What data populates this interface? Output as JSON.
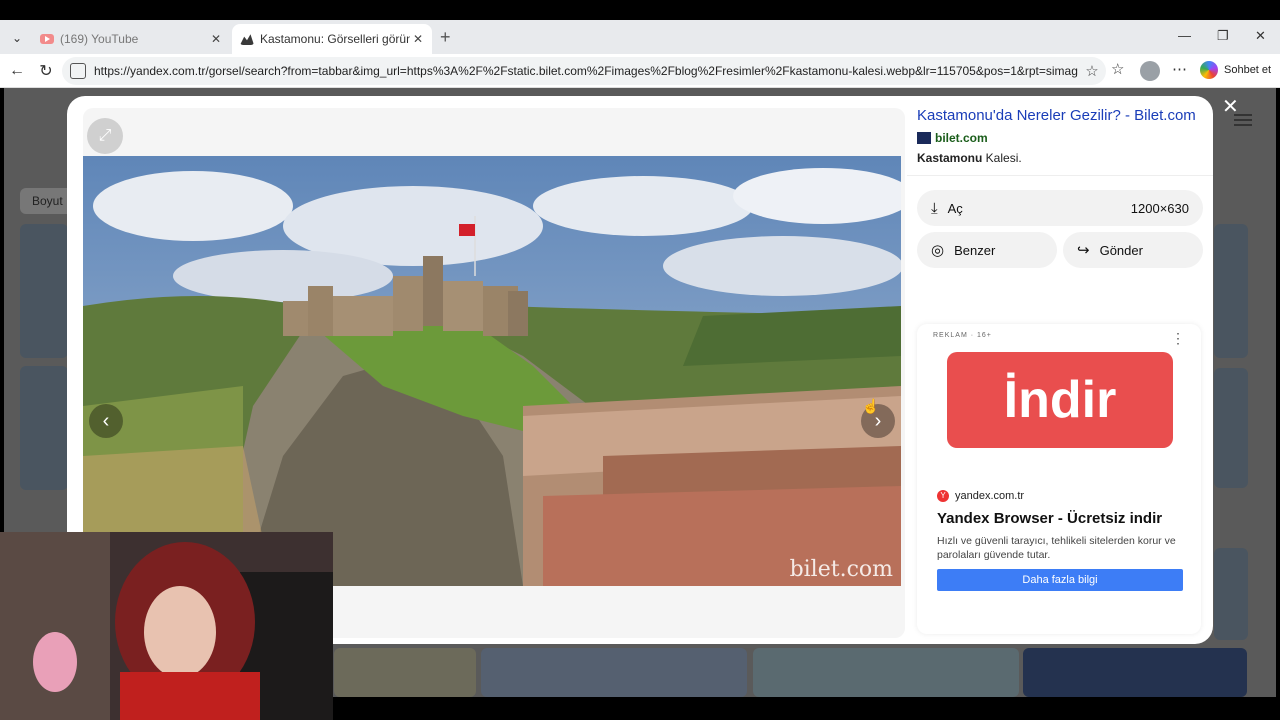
{
  "tabs": [
    {
      "title": "(169) YouTube",
      "close": "✕"
    },
    {
      "title": "Kastamonu: Görselleri görüntüleyin",
      "close": "✕"
    }
  ],
  "address_bar": {
    "url": "https://yandex.com.tr/gorsel/search?from=tabbar&img_url=https%3A%2F%2Fstatic.bilet.com%2Fimages%2Fblog%2Fresimler%2Fkastamonu-kalesi.webp&lr=115705&pos=1&rpt=simage&..."
  },
  "browser": {
    "chat_label": "Sohbet et"
  },
  "background": {
    "size_filter": "Boyut"
  },
  "viewer": {
    "watermark": "bilet.com"
  },
  "info": {
    "title": "Kastamonu'da Nereler Gezilir? - Bilet.com",
    "source": "bilet.com",
    "desc_bold": "Kastamonu",
    "desc_rest": " Kalesi.",
    "open_label": "Aç",
    "dimensions": "1200×630",
    "similar_label": "Benzer",
    "share_label": "Gönder"
  },
  "ad": {
    "label": "REKLAM · 16+",
    "banner_text": "İndir",
    "domain": "yandex.com.tr",
    "headline": "Yandex Browser - Ücretsiz indir",
    "body": "Hızlı ve güvenli tarayıcı, tehlikeli sitelerden korur ve parolaları güvende tutar.",
    "cta": "Daha fazla bilgi"
  },
  "colors": {
    "link": "#1a3db8",
    "ad_banner": "#e94e4e",
    "cta": "#3d7df6"
  }
}
